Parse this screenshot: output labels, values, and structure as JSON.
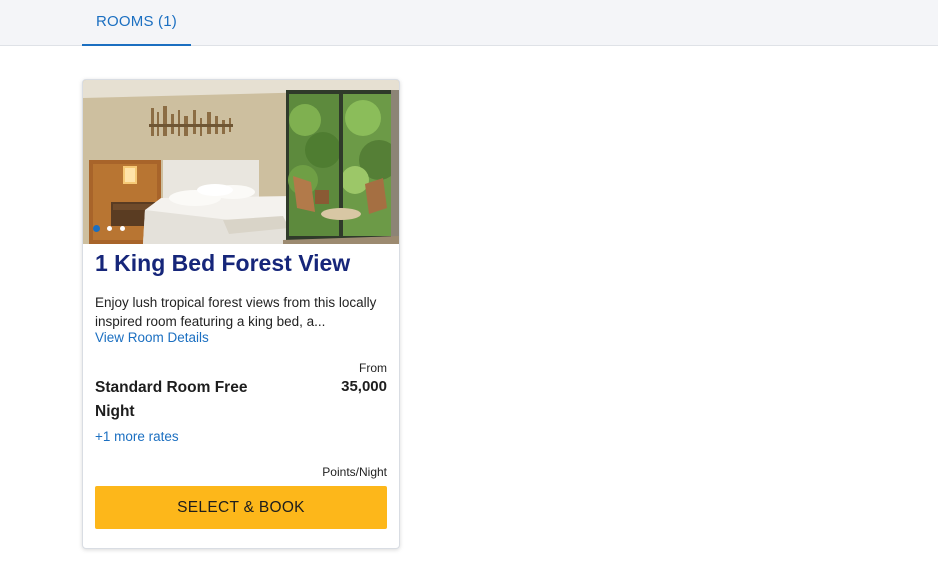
{
  "tabs": [
    {
      "label": "ROOMS (1)",
      "active": true
    }
  ],
  "room": {
    "image": "hotel room with king bed and forest-view windows",
    "carousel": {
      "count": 3,
      "active_index": 0
    },
    "title": "1 King Bed Forest View",
    "description": "Enjoy lush tropical forest views from this locally inspired room featuring a king bed, a...",
    "details_link": "View Room Details",
    "rate_name": "Standard Room Free Night",
    "more_rates_link": "+1 more rates",
    "price_prefix": "From",
    "price": "35,000",
    "price_unit": "Points/Night",
    "book_button": "SELECT & BOOK"
  },
  "colors": {
    "accent": "#1b6fc1",
    "title": "#16267a",
    "button": "#fdb71a"
  }
}
